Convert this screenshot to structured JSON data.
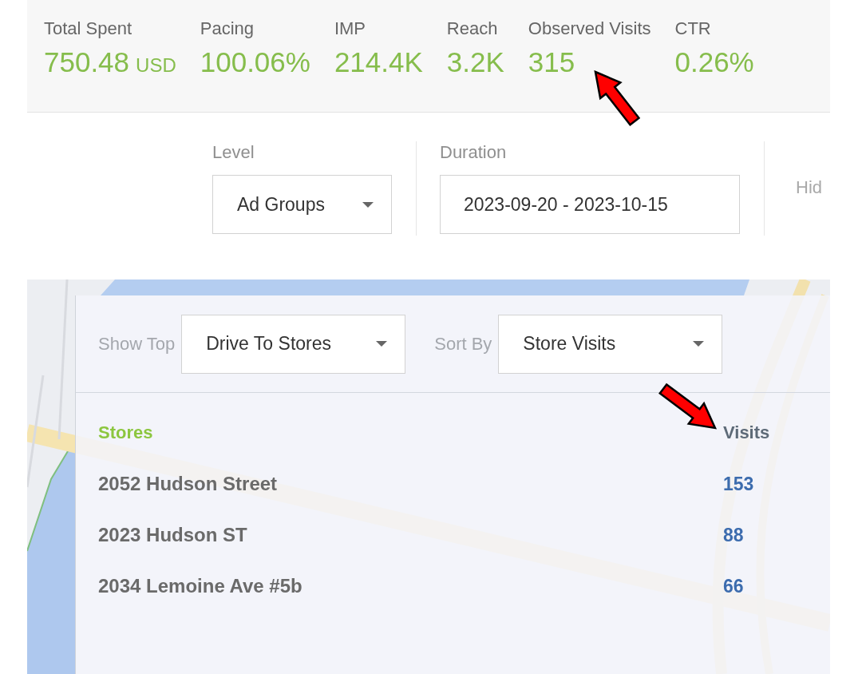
{
  "stats": [
    {
      "label": "Total Spent",
      "value": "750.48",
      "unit": "USD"
    },
    {
      "label": "Pacing",
      "value": "100.06%"
    },
    {
      "label": "IMP",
      "value": "214.4K"
    },
    {
      "label": "Reach",
      "value": "3.2K"
    },
    {
      "label": "Observed Visits",
      "value": "315"
    },
    {
      "label": "CTR",
      "value": "0.26%"
    }
  ],
  "filters": [
    {
      "kind": "dropdown",
      "label": "Level",
      "value": "Ad Groups"
    },
    {
      "kind": "date_range",
      "label": "Duration",
      "value": "2023-09-20 - 2023-10-15"
    },
    {
      "kind": "faded_label",
      "label": "Hid"
    }
  ],
  "store_panel": {
    "controls": [
      {
        "label": "Show Top",
        "value": "Drive To Stores"
      },
      {
        "label": "Sort By",
        "value": "Store Visits"
      }
    ],
    "table": {
      "columns": [
        "Stores",
        "Visits"
      ],
      "rows": [
        [
          "2052 Hudson Street",
          "153"
        ],
        [
          "2023 Hudson ST",
          "88"
        ],
        [
          "2034 Lemoine Ave #5b",
          "66"
        ]
      ]
    }
  }
}
